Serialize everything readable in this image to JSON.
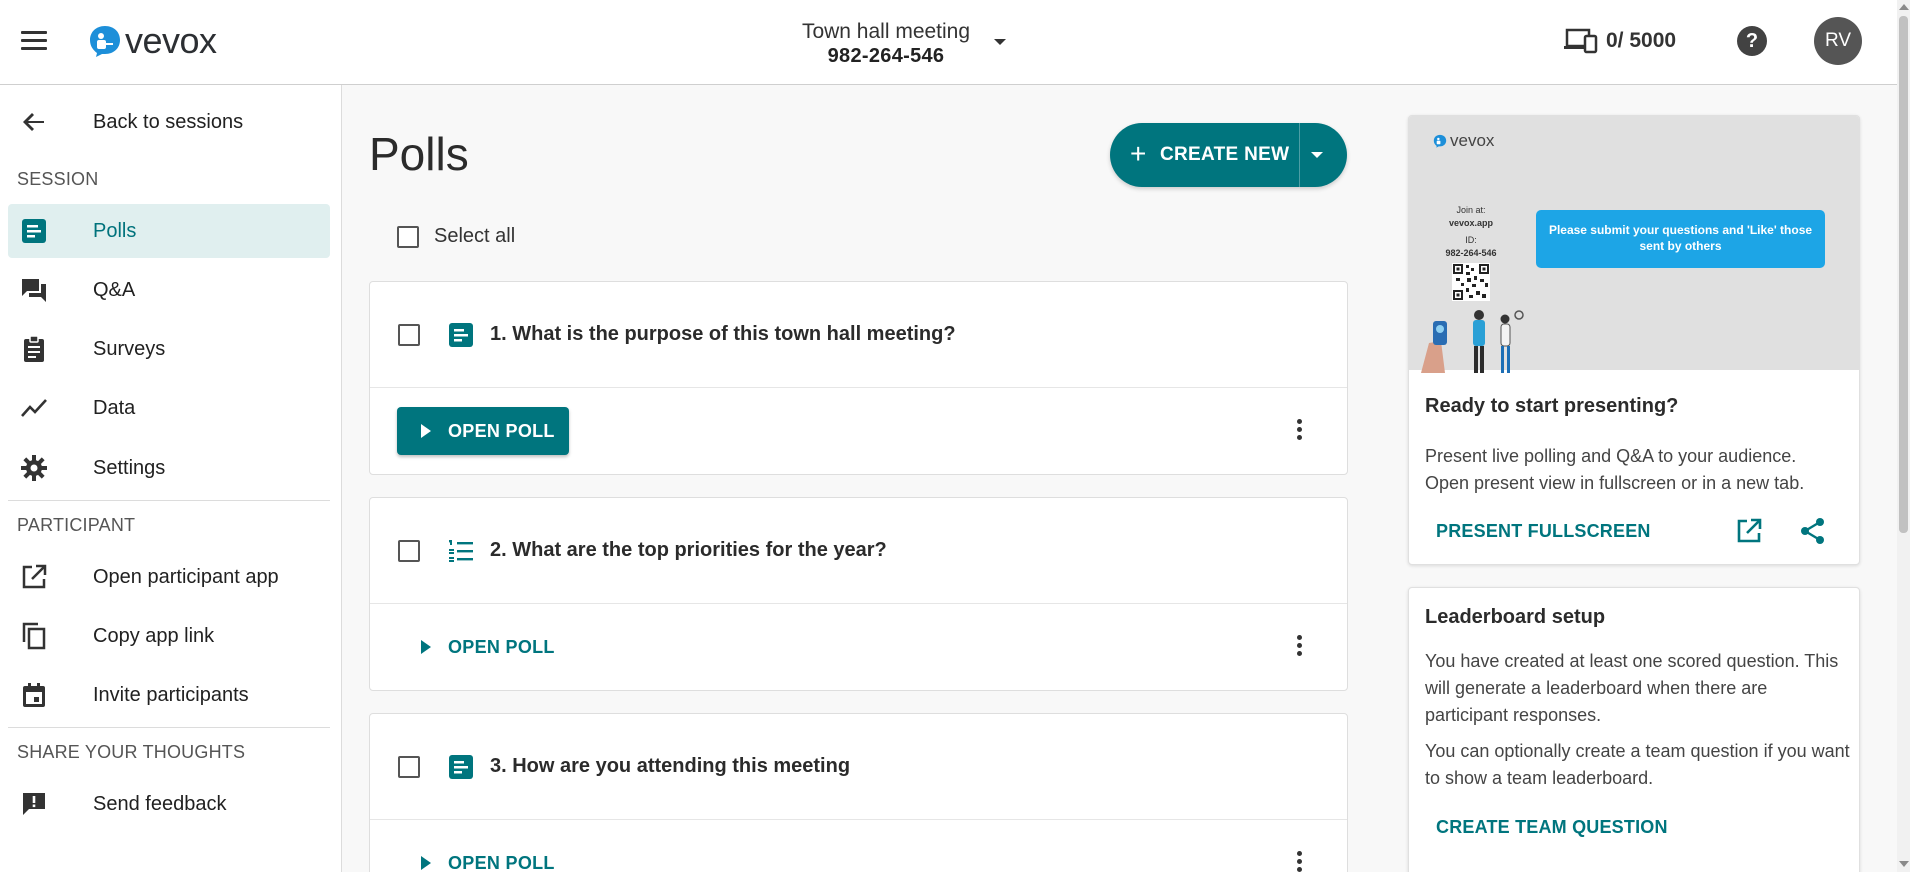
{
  "header": {
    "logo_text": "vevox",
    "session_name": "Town hall meeting",
    "session_code": "982-264-546",
    "device_count": "0/ 5000",
    "help": "?",
    "avatar_initials": "RV"
  },
  "sidebar": {
    "back_label": "Back to sessions",
    "session_section": "SESSION",
    "session_items": [
      {
        "label": "Polls",
        "icon": "poll-icon",
        "active": true
      },
      {
        "label": "Q&A",
        "icon": "chat-icon"
      },
      {
        "label": "Surveys",
        "icon": "clipboard-icon"
      },
      {
        "label": "Data",
        "icon": "trend-icon"
      },
      {
        "label": "Settings",
        "icon": "gear-icon"
      }
    ],
    "participant_section": "PARTICIPANT",
    "participant_items": [
      {
        "label": "Open participant app",
        "icon": "external-link-icon"
      },
      {
        "label": "Copy app link",
        "icon": "copy-icon"
      },
      {
        "label": "Invite participants",
        "icon": "calendar-icon"
      }
    ],
    "share_section": "SHARE YOUR THOUGHTS",
    "share_items": [
      {
        "label": "Send feedback",
        "icon": "feedback-icon"
      }
    ]
  },
  "main": {
    "title": "Polls",
    "create_label": "CREATE NEW",
    "select_all": "Select all",
    "polls": [
      {
        "question": "1. What is the purpose of this town hall meeting?",
        "icon": "poll-icon",
        "action": "OPEN POLL",
        "style": "filled"
      },
      {
        "question": "2. What are the top priorities for the year?",
        "icon": "ranked-list-icon",
        "action": "OPEN POLL",
        "style": "text"
      },
      {
        "question": "3. How are you attending this meeting",
        "icon": "poll-icon",
        "action": "OPEN POLL",
        "style": "text"
      }
    ]
  },
  "present_card": {
    "preview_logo": "vevox",
    "join_at": "Join at:",
    "join_url": "vevox.app",
    "id_label": "ID:",
    "id_value": "982-264-546",
    "preview_message": "Please submit your questions and 'Like' those sent by others",
    "title": "Ready to start presenting?",
    "description": "Present live polling and Q&A to your audience. Open present view in fullscreen or in a new tab.",
    "fullscreen_label": "PRESENT FULLSCREEN"
  },
  "leaderboard_card": {
    "title": "Leaderboard setup",
    "p1": "You have created at least one scored question. This will generate a leaderboard when there are participant responses.",
    "p2": "You can optionally create a team question if you want to show a team leaderboard.",
    "link": "CREATE TEAM QUESTION"
  },
  "colors": {
    "primary": "#00757e",
    "active_bg": "#e0efef",
    "logo_blue": "#1d8fd9",
    "bubble_blue": "#1da5e6"
  }
}
